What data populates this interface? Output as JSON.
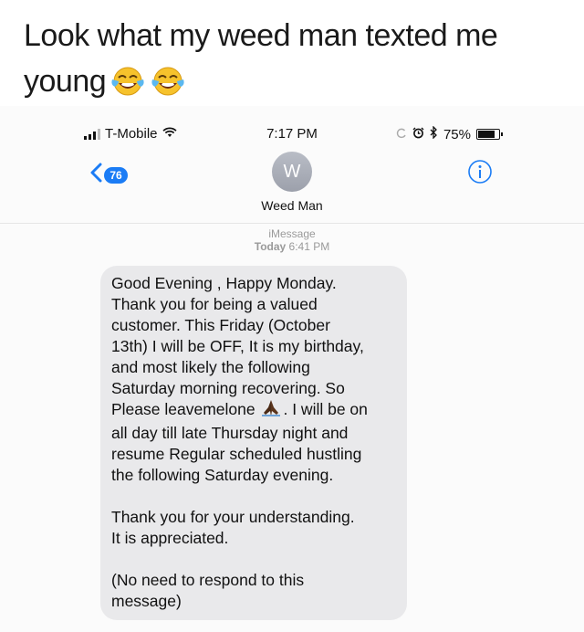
{
  "caption": {
    "line1": "Look what my weed man texted me",
    "line2": "young",
    "emoji_icons": [
      "laughing-tears-emoji-icon",
      "laughing-tears-emoji-icon"
    ]
  },
  "statusbar": {
    "carrier": "T-Mobile",
    "time": "7:17 PM",
    "battery_percent": "75%",
    "battery_level": 0.75
  },
  "navbar": {
    "back_count": "76",
    "avatar_initial": "W",
    "contact_name": "Weed Man",
    "accent_color": "#1b7cf5"
  },
  "thread": {
    "service": "iMessage",
    "day": "Today",
    "time": "6:41 PM"
  },
  "message": {
    "lines": [
      "Good Evening , Happy Monday.",
      "Thank you for being a valued",
      "customer. This Friday (October",
      "13th) I will be OFF, It is my birthday,",
      "and most likely the following",
      "Saturday morning recovering. So",
      "Please leavemelone",
      ". I will be on",
      "all day till late Thursday night and",
      "resume  Regular scheduled hustling",
      "the following Saturday evening.",
      "Thank you for your understanding.",
      "It is appreciated.",
      "(No need to respond to this",
      "message)"
    ],
    "inline_icon": "praying-hands-emoji-icon",
    "bubble_color": "#e9e9eb"
  }
}
